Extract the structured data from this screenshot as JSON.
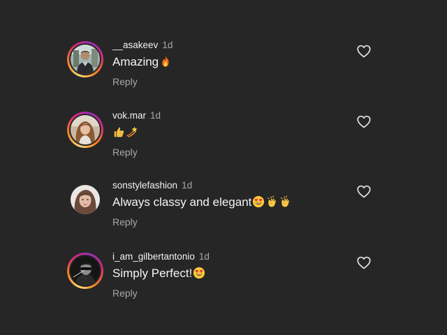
{
  "comments": [
    {
      "username": "__asakeev",
      "time": "1d",
      "text": "Amazing",
      "emojis": [
        "fire"
      ],
      "reply": "Reply",
      "story_ring": true
    },
    {
      "username": "vok.mar",
      "time": "1d",
      "text": "",
      "emojis": [
        "thumbs-up",
        "dizzy"
      ],
      "reply": "Reply",
      "story_ring": true
    },
    {
      "username": "sonstylefashion",
      "time": "1d",
      "text": "Always classy and elegant",
      "emojis": [
        "heart-eyes",
        "clapping",
        "clapping"
      ],
      "reply": "Reply",
      "story_ring": false
    },
    {
      "username": "i_am_gilbertantonio",
      "time": "1d",
      "text": "Simply Perfect!",
      "emojis": [
        "heart-eyes"
      ],
      "reply": "Reply",
      "story_ring": true
    }
  ],
  "colors": {
    "background": "#262626",
    "primary_text": "#f5f5f5",
    "secondary_text": "#a8a8a8"
  }
}
